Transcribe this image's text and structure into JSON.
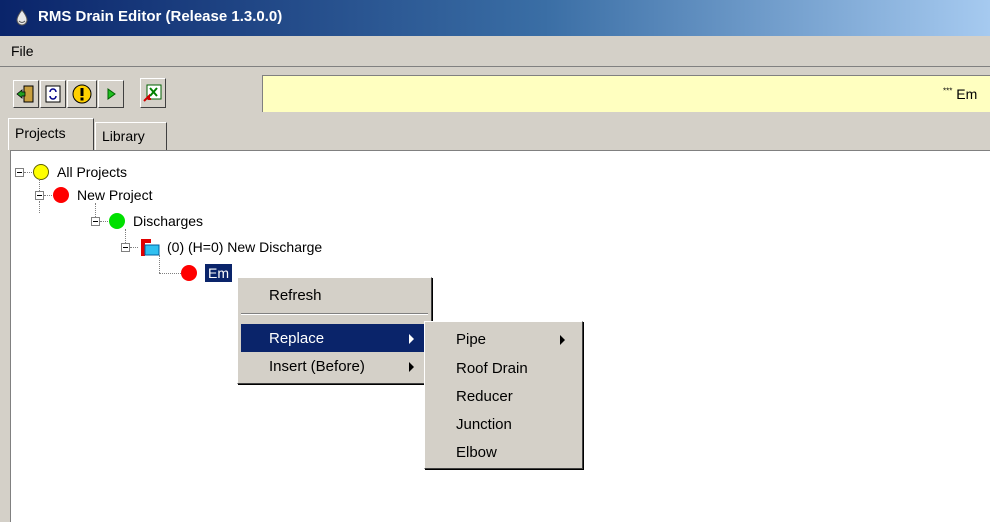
{
  "window": {
    "title": "RMS Drain Editor (Release 1.3.0.0)"
  },
  "menu": {
    "file": "File"
  },
  "toolbar": {
    "buttons": [
      "exit-icon",
      "refresh-icon",
      "warning-icon",
      "run-icon",
      "excel-export-icon"
    ],
    "message": "Em",
    "message_prefix": "***"
  },
  "tabs": [
    {
      "label": "Projects",
      "active": true
    },
    {
      "label": "Library",
      "active": false
    }
  ],
  "tree": {
    "all_projects": "All Projects",
    "project": "New Project",
    "discharges": "Discharges",
    "discharge": "(0) (H=0) New Discharge",
    "selected_item": "Em"
  },
  "context_menu": {
    "refresh": "Refresh",
    "replace": "Replace",
    "insert_before": "Insert (Before)"
  },
  "submenu": {
    "items": [
      "Pipe",
      "Roof Drain",
      "Reducer",
      "Junction",
      "Elbow"
    ]
  },
  "colors": {
    "selection": "#0a246a",
    "message_bg": "#ffffc0",
    "face": "#d4d0c8"
  }
}
